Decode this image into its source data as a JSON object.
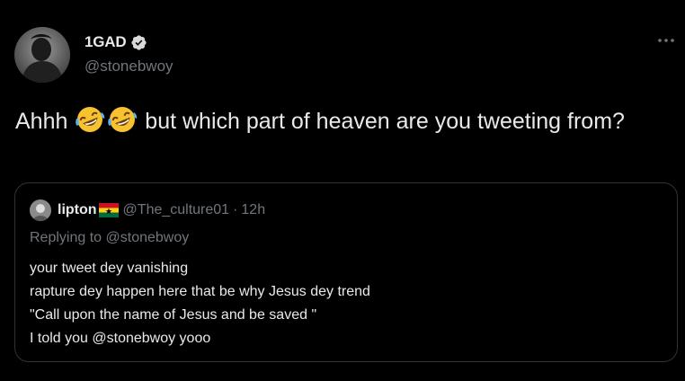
{
  "author": {
    "display_name": "1GAD",
    "handle": "@stonebwoy",
    "verified": true,
    "avatar_icon": "avatar-photo"
  },
  "tweet": {
    "text_before": "Ahhh",
    "emoji": [
      "rolling-on-floor-laughing",
      "rolling-on-floor-laughing"
    ],
    "text_after": "but which part of heaven are you tweeting from?"
  },
  "quoted_tweet": {
    "display_name": "lipton",
    "flag_icon": "ghana-flag-icon",
    "handle": "@The_culture01",
    "separator": "·",
    "time": "12h",
    "replying_to_label": "Replying to",
    "replying_to_handle": "@stonebwoy",
    "lines": [
      "your tweet dey vanishing",
      "rapture dey happen here that be why Jesus dey trend",
      "\"Call upon the name of Jesus and be saved \"",
      "I told you @stonebwoy yooo"
    ]
  },
  "colors": {
    "background": "#000000",
    "text": "#e7e9ea",
    "muted": "#71767b",
    "border": "#2f3336",
    "verified_badge": "#d9d9d9"
  }
}
